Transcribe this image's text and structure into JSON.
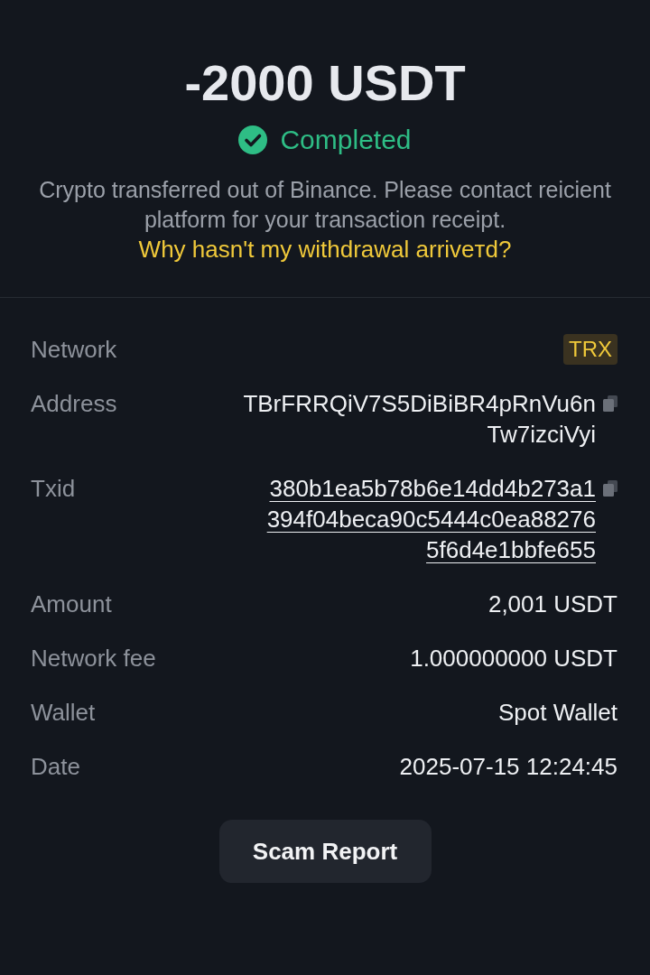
{
  "header": {
    "amount": "-2000 USDT",
    "status": {
      "kind": "completed",
      "label": "Completed"
    },
    "description": "Crypto transferred out of Binance. Please contact reicient platform for your transaction receipt.",
    "help_link": "Why hasn't my withdrawal arriveтd?"
  },
  "details": [
    {
      "label": "Network",
      "kind": "tag",
      "value": "TRX"
    },
    {
      "label": "Address",
      "kind": "copyable",
      "lines": [
        "TBrFRRQiV7S5DiBiBR4pRnVu6n",
        "Tw7izciVyi"
      ]
    },
    {
      "label": "Txid",
      "kind": "link",
      "lines": [
        "380b1ea5b78b6e14dd4b273a1",
        "394f04beca90c5444c0ea88276",
        "5f6d4e1bbfe655"
      ]
    },
    {
      "label": "Amount",
      "kind": "text",
      "value": "2,001 USDT"
    },
    {
      "label": "Network fee",
      "kind": "text",
      "value": "1.000000000 USDT"
    },
    {
      "label": "Wallet",
      "kind": "text",
      "value": "Spot Wallet"
    },
    {
      "label": "Date",
      "kind": "text",
      "value": "2025-07-15 12:24:45"
    }
  ],
  "button": {
    "label": "Scam Report"
  }
}
